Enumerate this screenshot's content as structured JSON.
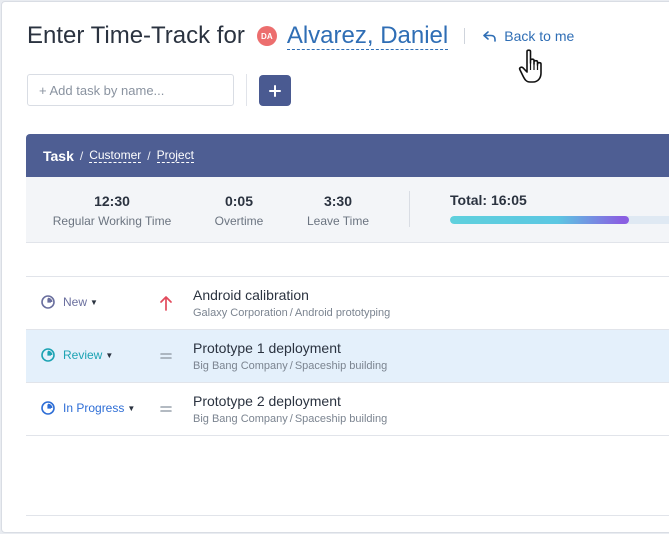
{
  "header": {
    "title": "Enter Time-Track for",
    "user_initials": "DA",
    "user_name": "Alvarez, Daniel",
    "back_label": "Back to me"
  },
  "add_task": {
    "placeholder": "+ Add task by name...",
    "add_button_icon": "plus-icon"
  },
  "table_header": {
    "task": "Task",
    "customer": "Customer",
    "project": "Project",
    "separator": "/"
  },
  "summary": {
    "regular": {
      "value": "12:30",
      "label": "Regular Working Time"
    },
    "overtime": {
      "value": "0:05",
      "label": "Overtime"
    },
    "leave": {
      "value": "3:30",
      "label": "Leave Time"
    },
    "total_label": "Total: 16:05",
    "progress_fraction": 0.69
  },
  "tasks": [
    {
      "status": "New",
      "status_color": "#6a6f9e",
      "priority": "high",
      "priority_color": "#e24a5c",
      "name": "Android calibration",
      "customer": "Galaxy Corporation",
      "project": "Android prototyping",
      "selected": false
    },
    {
      "status": "Review",
      "status_color": "#1ca3b3",
      "priority": "normal",
      "priority_color": "#9aa3ad",
      "name": "Prototype 1 deployment",
      "customer": "Big Bang Company",
      "project": "Spaceship building",
      "selected": true
    },
    {
      "status": "In Progress",
      "status_color": "#2e6ed6",
      "priority": "normal",
      "priority_color": "#9aa3ad",
      "name": "Prototype 2 deployment",
      "customer": "Big Bang Company",
      "project": "Spaceship building",
      "selected": false
    }
  ],
  "colors": {
    "accent": "#2f6eb5",
    "header_bar": "#4e5e93",
    "avatar": "#ec6e6e"
  }
}
